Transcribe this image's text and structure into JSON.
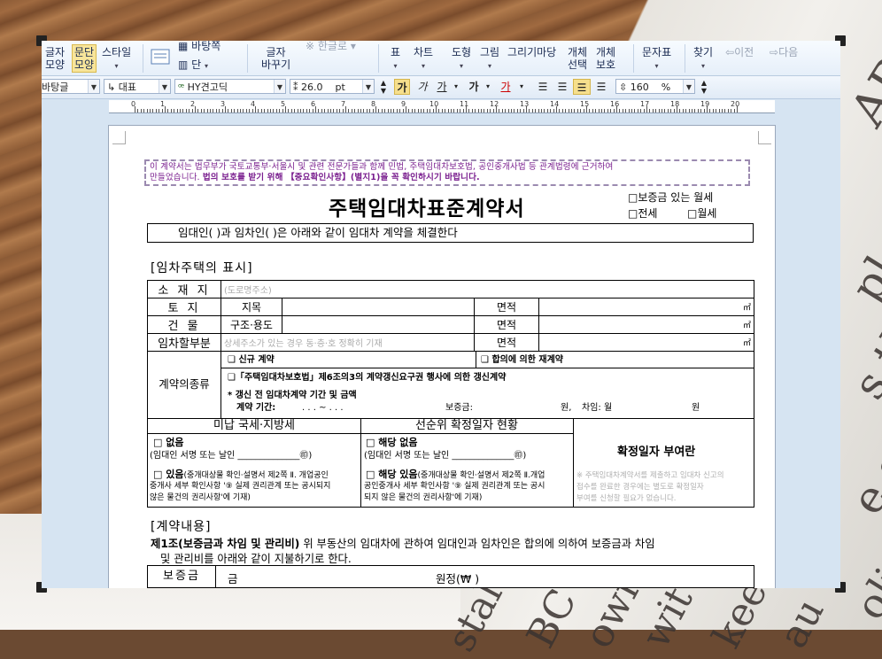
{
  "ribbon": {
    "char_shape": "글자\n모양",
    "para_shape": "문단\n모양",
    "style": "스타일",
    "background": "바탕쪽",
    "columns": "단",
    "char_change": "글자\n바꾸기",
    "hanja": "한글로",
    "table": "표",
    "chart": "차트",
    "shape": "도형",
    "picture": "그림",
    "drawing": "그리기마당",
    "obj_select": "개체\n선택",
    "obj_protect": "개체\n보호",
    "char_table": "문자표",
    "find": "찾기",
    "prev": "이전",
    "next": "다음"
  },
  "toolbar": {
    "style_combo": "바탕글",
    "lang_combo": "대표",
    "font_combo": "HY견고딕",
    "size_value": "26.0",
    "size_unit": "pt",
    "bold": "가",
    "italic": "가",
    "underline": "가",
    "strike": "가",
    "color": "가",
    "line_spacing": "160",
    "line_unit": "%"
  },
  "ruler": {
    "labels": [
      "0",
      "1",
      "2",
      "3",
      "4",
      "5",
      "6",
      "7",
      "8",
      "9",
      "10",
      "11",
      "12",
      "13",
      "14",
      "15",
      "16",
      "17",
      "18",
      "19",
      "20"
    ]
  },
  "document": {
    "notice_plain": "이 계약서는 법무부가 국토교통부·서울시 및 관련 전문가들과 함께 민법, 주택임대차보호법, 공인중개사법 등 관계법령에 근거하여",
    "notice_plain2": "만들었습니다.",
    "notice_bold": "법의 보호를 받기 위해 【중요확인사항】(별지1)을 꼭 확인하시기 바랍니다.",
    "title": "주택임대차표준계약서",
    "opt_monthly_deposit": "□보증금 있는 월세",
    "opt_jeonse": "□전세",
    "opt_monthly": "□월세",
    "party_line": "임대인(                     )과 임차인(                     )은 아래와 같이 임대차 계약을 체결한다",
    "section1": "[임차주택의 표시]",
    "loc_label": "소 재 지",
    "loc_hint": "(도로명주소)",
    "land_label": "토  지",
    "land_kind": "지목",
    "area": "면적",
    "sqm": "㎡",
    "bldg_label": "건  물",
    "bldg_kind": "구조·용도",
    "rent_part_label": "임차할부분",
    "rent_part_hint": "상세주소가 있는 경우 동·층·호 정확히 기재",
    "contract_type_label": "계약의종류",
    "new_contract": "❑ 신규 계약",
    "agreed_renew": "❑ 합의에 의한 재계약",
    "renewal": "❑「주택임대차보호법」제6조의3의 계약갱신요구권 행사에 의한 갱신계약",
    "prev_terms": "* 갱신 전 임대차계약 기간 및 금액",
    "contract_period": "계약 기간:",
    "period_dots": ".     .     .   ~     .     .     .",
    "deposit_short": "보증금:",
    "won": "원,",
    "rent_short": "차임: 월",
    "won2": "원",
    "tax_header": "미납 국세·지방세",
    "priority_header": "선순위 확정일자 현황",
    "none": "□ 없음",
    "sign_line": "(임대인 서명 또는 날인 ______________㊞)",
    "exists": "□ 있음",
    "exists_note": "(중개대상물 확인·설명서 제2쪽 Ⅱ. 개업공인",
    "exists_note2": "중개사 세부 확인사항 '⑨ 실제 권리관계 또는 공시되지",
    "exists_note3": "않은 물건의 권리사항'에 기재)",
    "na": "□ 해당 없음",
    "sign_line2": "(임대인 서명 또는 날인 ______________㊞)",
    "applicable": "□ 해당 있음",
    "app_note": "(중개대상물 확인·설명서 제2쪽 Ⅱ.개업",
    "app_note2": "공인중개사 세부 확인사항 '⑨ 실제 권리관계 또는 공시",
    "app_note3": "되지 않은 물건의 권리사항'에 기재)",
    "fixed_date": "확정일자 부여란",
    "fixed_note": "※ 주택임대차계약서를 제출하고 임대차 신고의",
    "fixed_note2": "접수를 완료한 경우에는 별도로 확정일자",
    "fixed_note3": "부여를 신청할 필요가 없습니다.",
    "section2": "[계약내용]",
    "clause1_title": "제1조(보증금과 차임 및 관리비)",
    "clause1_text": " 위 부동산의 임대차에 관하여 임대인과 임차인은 합의에 의하여 보증금과 차임",
    "clause1_text2": "및 관리비를 아래와 같이 지불하기로 한다.",
    "deposit_label": "보증금",
    "amount": "금",
    "won_unit": "원정(₩                               )"
  },
  "background": {
    "text_a": "ABC",
    "text_b": "ployn",
    "text_c": "s tha",
    "text_d": "otice",
    "text_e": "e stri",
    "text_f": "orize",
    "text_g": "olinar",
    "text_h": "stal",
    "text_i": "BC",
    "text_j": "owi",
    "text_k": "wit",
    "text_l": "kee",
    "text_m": "au"
  }
}
